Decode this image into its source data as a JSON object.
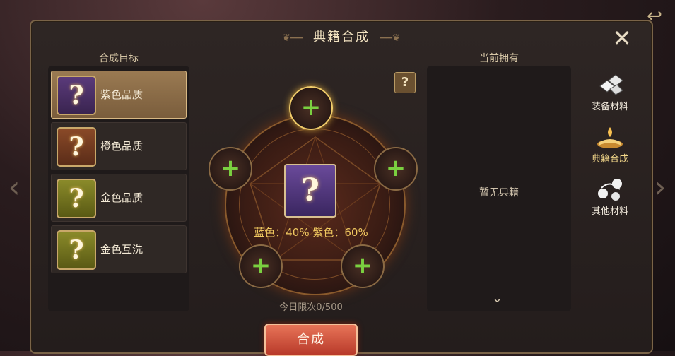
{
  "title": "典籍合成",
  "left": {
    "header": "合成目标",
    "items": [
      {
        "label": "紫色品质",
        "color": "purple",
        "selected": true
      },
      {
        "label": "橙色品质",
        "color": "orange",
        "selected": false
      },
      {
        "label": "金色品质",
        "color": "gold",
        "selected": false
      },
      {
        "label": "金色互洗",
        "color": "gold",
        "selected": false
      }
    ]
  },
  "center": {
    "question_glyph": "?",
    "plus_glyph": "+",
    "rates_text": "蓝色：40%  紫色：60%",
    "daily_limit": "今日限次0/500",
    "help_glyph": "?"
  },
  "right": {
    "header": "当前拥有",
    "empty_text": "暂无典籍",
    "more_glyph": "⌄"
  },
  "tabs": [
    {
      "label": "装备材料",
      "icon": "equipment-material-icon",
      "active": false
    },
    {
      "label": "典籍合成",
      "icon": "book-synthesis-icon",
      "active": true
    },
    {
      "label": "其他材料",
      "icon": "other-material-icon",
      "active": false
    }
  ],
  "synthesize_button": "合成",
  "close_glyph": "✕",
  "colors": {
    "accent": "#f0c860",
    "plus": "#7ad040",
    "button": "#d05a40"
  }
}
